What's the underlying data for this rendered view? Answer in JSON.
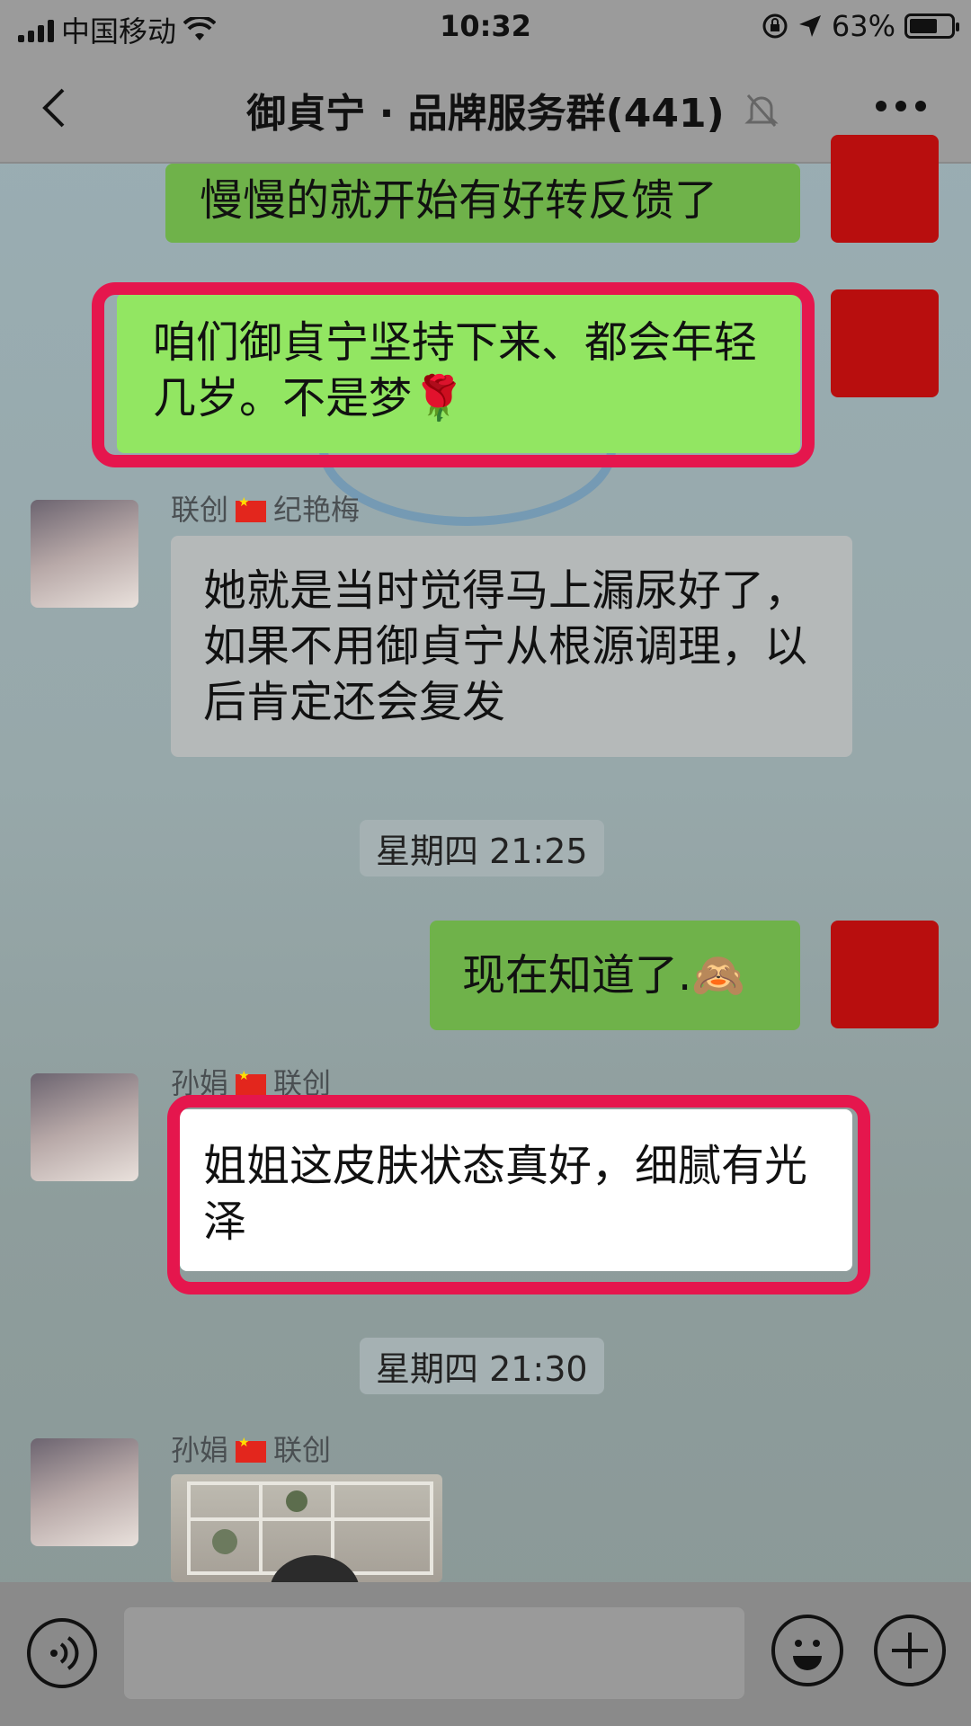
{
  "status_bar": {
    "carrier": "中国移动",
    "time": "10:32",
    "battery": "63%"
  },
  "nav": {
    "title": "御貞宁 · 品牌服务群(441)"
  },
  "messages": [
    {
      "id": "m1",
      "side": "self",
      "text": "慢慢的就开始有好转反馈了"
    },
    {
      "id": "m2",
      "side": "self",
      "text": "咱们御貞宁坚持下来、都会年轻几岁。不是梦🌹",
      "highlighted": true
    },
    {
      "id": "m3",
      "side": "other",
      "sender_left": "联创",
      "sender_right": "纪艳梅",
      "text": "她就是当时觉得马上漏尿好了，如果不用御貞宁从根源调理，以后肯定还会复发"
    },
    {
      "id": "t1",
      "type": "timestamp",
      "text": "星期四 21:25"
    },
    {
      "id": "m4",
      "side": "self",
      "text": "现在知道了.🙈"
    },
    {
      "id": "m5",
      "side": "other",
      "sender_left": "孙娟",
      "sender_right": "联创",
      "text": "姐姐这皮肤状态真好，细腻有光泽",
      "highlighted": true
    },
    {
      "id": "t2",
      "type": "timestamp",
      "text": "星期四 21:30"
    },
    {
      "id": "m6",
      "side": "other",
      "sender_left": "孙娟",
      "sender_right": "联创",
      "type": "image"
    }
  ],
  "colors": {
    "highlight": "#e5164d",
    "self_bubble": "#92e662",
    "other_bubble": "#ffffff"
  },
  "icons": [
    "back-icon",
    "mute-icon",
    "more-icon",
    "voice-icon",
    "emoji-icon",
    "plus-icon",
    "wifi-icon",
    "location-icon",
    "rotation-lock-icon"
  ]
}
